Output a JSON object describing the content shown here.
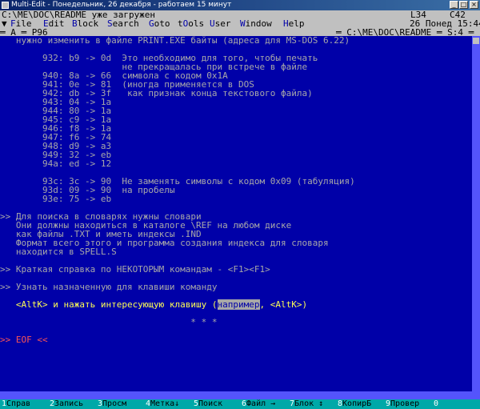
{
  "window": {
    "title": "Multi-Edit - Понедельник, 26 декабря - работаем 15 минут"
  },
  "status": {
    "path": "C:\\ME\\DOC\\README уже загружен",
    "line": "L34",
    "col": "C42",
    "path2": "C:\\ME\\DOC\\README",
    "date": "26 Понед 15:44"
  },
  "menu": {
    "marker": "▼",
    "items": [
      "File",
      "Edit",
      "Block",
      "Search",
      "Goto",
      "tOols",
      "User",
      "Window",
      "Help"
    ]
  },
  "tabbar": {
    "left": "═ A ═ P96 ",
    "right": "═ C:\\ME\\DOC\\README ═ S:4 ═"
  },
  "editor": {
    "lines": [
      "   нужно изменить в файле PRINT.EXE байты (адреса для MS-DOS 6.22)",
      "",
      "        932: b9 -> 0d  Это необходимо для того, чтобы печать",
      "                       не прекращалась при встрече в файле",
      "        940: 8a -> 66  символа с кодом 0x1A",
      "        941: 0e -> 81  (иногда применяется в DOS",
      "        942: db -> 3f   как признак конца текстового файла)",
      "        943: 04 -> 1a",
      "        944: 80 -> 1a",
      "        945: c9 -> 1a",
      "        946: f8 -> 1a",
      "        947: f6 -> 74",
      "        948: d9 -> a3",
      "        949: 32 -> eb",
      "        94a: ed -> 12",
      "",
      "        93c: 3c -> 90  Не заменять символы с кодом 0x09 (табуляция)",
      "        93d: 09 -> 90  на пробелы",
      "        93e: 75 -> eb",
      "",
      ">> Для поиска в словарях нужны словари",
      "   Они должны находиться в каталоге \\REF на любом диске",
      "   как файлы .TXT и иметь индексы .IND",
      "   Формат всего этого и программа создания индекса для словаря",
      "   находится в SPELL.S",
      "",
      ">> Краткая справка по НЕКОТОРЫМ командам - <F1><F1>",
      "",
      ">> Узнать назначенную для клавиши команду",
      "",
      "",
      "",
      "                                    * * *",
      "",
      ">> EOF <<"
    ],
    "alt_before": "   <AltK> и нажать интересующую клавишу (",
    "alt_sel": "например",
    "alt_after": ", <AltK>)"
  },
  "function_keys": [
    {
      "num": "1",
      "label": "Справ"
    },
    {
      "num": "2",
      "label": "Запись"
    },
    {
      "num": "3",
      "label": "Просм"
    },
    {
      "num": "4",
      "label": "Метка↓"
    },
    {
      "num": "5",
      "label": "Поиск"
    },
    {
      "num": "6",
      "label": "Файл →"
    },
    {
      "num": "7",
      "label": "Блок ↕"
    },
    {
      "num": "8",
      "label": "КопирБ"
    },
    {
      "num": "9",
      "label": "Провер"
    },
    {
      "num": "0",
      "label": ""
    }
  ]
}
